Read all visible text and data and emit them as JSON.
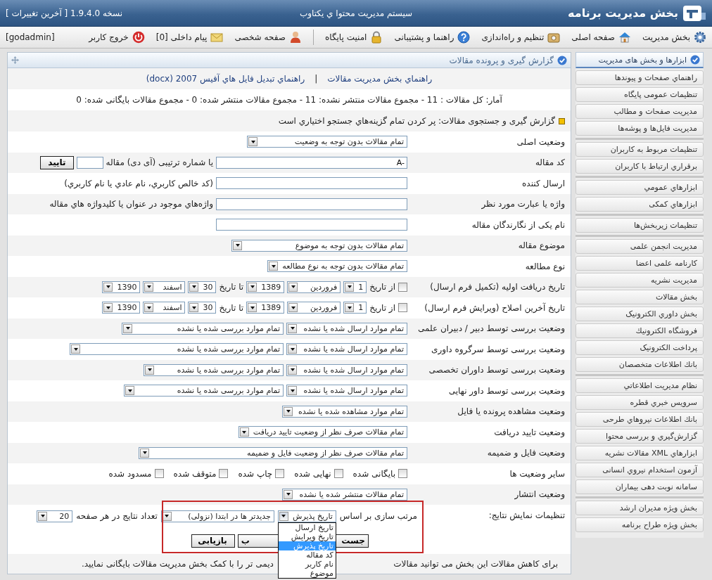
{
  "header": {
    "title": "بخش مدیریت برنامه",
    "subtitle": "سیستم مدیریت محتوا ي يکتاوب",
    "version": "نسخه 1.9.4.0 [ آخرین تغییرات ]"
  },
  "toolbar": {
    "groups": [
      {
        "items": [
          {
            "kind": "gear",
            "label": "بخش مدیریت"
          },
          {
            "kind": "home",
            "label": "صفحه اصلی"
          },
          {
            "kind": "setup",
            "label": "تنظیم و راه‌اندازی"
          },
          {
            "kind": "help",
            "label": "راهنما و پشتیبانی"
          },
          {
            "kind": "lock",
            "label": "امنیت پایگاه"
          }
        ]
      },
      {
        "items": [
          {
            "kind": "person",
            "label": "صفحه شخصی"
          },
          {
            "kind": "mail",
            "label": "پیام داخلی [0]"
          },
          {
            "kind": "power",
            "label": "خروج کاربر"
          }
        ]
      }
    ],
    "user": "[godadmin]"
  },
  "sidebar": {
    "heading": "ابزارها و بخش های مدیریت",
    "groups": [
      {
        "items": [
          "راهنماي صفحات و پیوندها",
          "تنظیمات عمومی پایگاه",
          "مدیریت صفحات و مطالب",
          "مدیریت فایل‌ها و پوشه‌ها"
        ]
      },
      {
        "items": [
          "تنظیمات مربوط به کاربران",
          "برقراري ارتباط با کاربران"
        ]
      },
      {
        "items": [
          "ابزارهاي عمومي",
          "ابزارهاي کمکی"
        ]
      },
      {
        "items": [
          "تنظیمات زیربخش‌ها"
        ]
      },
      {
        "items": [
          "مدیریت انجمن علمی",
          "کارنامه علمی اعضا",
          "مدیریت نشریه",
          "بخش مقالات",
          "بخش داوري الکترونیک",
          "فروشگاه الکترونیك",
          "پرداخت الکترونیک",
          "بانك اطلاعات متخصصان"
        ]
      },
      {
        "items": [
          "نظام مدیریت اطلاعاتي",
          "سرويس خبري قطره",
          "بانك اطلاعات نیروهاي طرحی",
          "گزارش‌گیري و بررسی محتوا",
          "ابزارهاي XML مقالات نشریه",
          "آزمون استخدام نیروي انسانی",
          "سامانه نوبت دهی بیماران"
        ]
      },
      {
        "items": [
          "بخش ویژه مدیران ارشد",
          "بخش ویژه طراح برنامه"
        ]
      }
    ]
  },
  "panel": {
    "title": "گزارش گیری و پرونده مقالات",
    "links": [
      "راهنماي بخش مدیریت مقالات",
      "راهنماي تبدیل فایل هاي آفیس 2007 (docx)"
    ],
    "link_separator": "|",
    "stats": "آمار: کل مقالات : 11 - مجموع مقالات منتشر نشده: 11 - مجموع مقالات منتشر شده: 0 - مجموع مقالات بایگانی شده: 0",
    "search_heading": "گزارش گیری و جستجوی مقالات: پر کردن تمام گزینه‌هاي جستجو اختیاري است",
    "rows": [
      {
        "label": "وضعیت اصلی",
        "controls": [
          {
            "kind": "select",
            "value": "تمام مقالات بدون توجه به وضعیت"
          }
        ]
      },
      {
        "label": "کد مقاله",
        "controls": [
          {
            "kind": "input",
            "value": "A-"
          },
          {
            "kind": "text",
            "text": "یا شماره ترتیبی (آی دی) مقاله"
          },
          {
            "kind": "input"
          },
          {
            "kind": "button",
            "label": "تایید"
          }
        ]
      },
      {
        "label": "ارسال کننده",
        "controls": [
          {
            "kind": "input"
          },
          {
            "kind": "text",
            "text": "(کد خالص کاربري، نام عادي یا نام کاربري)"
          }
        ]
      },
      {
        "label": "واژه یا عبارت مورد نظر",
        "controls": [
          {
            "kind": "input"
          },
          {
            "kind": "text",
            "text": "واژه‌هاي موجود در عنوان یا کلیدواژه هاي مقاله"
          }
        ]
      },
      {
        "label": "نام یکی از نگارندگان مقاله",
        "controls": [
          {
            "kind": "input"
          }
        ]
      },
      {
        "label": "موضوع مقاله",
        "controls": [
          {
            "kind": "select",
            "value": "تمام مقالات بدون توجه به موضوع"
          }
        ]
      },
      {
        "label": "نوع مطالعه",
        "controls": [
          {
            "kind": "select",
            "value": "تمام مقالات بدون توجه به نوع مطالعه"
          }
        ]
      },
      {
        "label": "تاریخ دریافت اولیه (تکمیل فرم ارسال)",
        "controls": [
          {
            "kind": "checkbox",
            "checked": false
          },
          {
            "kind": "text",
            "text": "از تاریخ"
          },
          {
            "kind": "select",
            "value": "1"
          },
          {
            "kind": "select",
            "value": "فروردین"
          },
          {
            "kind": "select",
            "value": "1389"
          },
          {
            "kind": "text",
            "text": "تا تاریخ"
          },
          {
            "kind": "select",
            "value": "30"
          },
          {
            "kind": "select",
            "value": "اسفند"
          },
          {
            "kind": "select",
            "value": "1390"
          }
        ]
      },
      {
        "label": "تاریخ آخرین اصلاح (ویرایش فرم ارسال)",
        "controls": [
          {
            "kind": "checkbox",
            "checked": false
          },
          {
            "kind": "text",
            "text": "از تاریخ"
          },
          {
            "kind": "select",
            "value": "1"
          },
          {
            "kind": "select",
            "value": "فروردین"
          },
          {
            "kind": "select",
            "value": "1389"
          },
          {
            "kind": "text",
            "text": "تا تاریخ"
          },
          {
            "kind": "select",
            "value": "30"
          },
          {
            "kind": "select",
            "value": "اسفند"
          },
          {
            "kind": "select",
            "value": "1390"
          }
        ]
      },
      {
        "label": "وضعیت بررسی توسط دبیر / دبیران علمی",
        "controls": [
          {
            "kind": "select",
            "value": "تمام موارد ارسال شده یا نشده"
          },
          {
            "kind": "select",
            "value": "تمام موارد بررسی شده یا نشده"
          }
        ]
      },
      {
        "label": "وضعیت بررسی توسط سرگروه داوری",
        "controls": [
          {
            "kind": "select",
            "value": "تمام موارد ارسال شده یا نشده"
          },
          {
            "kind": "select",
            "value": "تمام موارد بررسی شده یا نشده"
          }
        ]
      },
      {
        "label": "وضعیت بررسی توسط داوران تخصصی",
        "controls": [
          {
            "kind": "select",
            "value": "تمام موارد ارسال شده یا نشده"
          },
          {
            "kind": "select",
            "value": "تمام موارد بررسی شده یا نشده"
          }
        ]
      },
      {
        "label": "وضعیت بررسی توسط داور نهایی",
        "controls": [
          {
            "kind": "select",
            "value": "تمام موارد ارسال شده یا نشده"
          },
          {
            "kind": "select",
            "value": "تمام موارد بررسی شده یا نشده"
          }
        ]
      },
      {
        "label": "وضعیت مشاهده پرونده یا فایل",
        "controls": [
          {
            "kind": "select",
            "value": "تمام موارد مشاهده شده یا نشده"
          }
        ]
      },
      {
        "label": "وضعیت تایید دریافت",
        "controls": [
          {
            "kind": "select",
            "value": "تمام مقالات صرف نظر از وضعیت تایید دریافت"
          }
        ]
      },
      {
        "label": "وضعیت فایل و ضمیمه",
        "controls": [
          {
            "kind": "select",
            "value": "تمام مقالات صرف نظر از وضعیت فایل و ضمیمه"
          }
        ]
      },
      {
        "label": "سایر وضعیت ها",
        "controls": [
          {
            "kind": "checkbox",
            "checked": false,
            "label": "بایگانی شده"
          },
          {
            "kind": "checkbox",
            "checked": false,
            "label": "نهایی شده"
          },
          {
            "kind": "checkbox",
            "checked": false,
            "label": "چاپ شده"
          },
          {
            "kind": "checkbox",
            "checked": false,
            "label": "متوقف شده"
          },
          {
            "kind": "checkbox",
            "checked": false,
            "label": "مسدود شده"
          }
        ]
      },
      {
        "label": "وضعیت انتشار",
        "controls": [
          {
            "kind": "select",
            "value": "تمام مقالات منتشر شده یا نشده"
          }
        ]
      }
    ],
    "settings": {
      "label": "تنظیمات نمایش نتایج:",
      "highlighted": true,
      "controls": [
        {
          "kind": "text",
          "text": "مرتب سازی بر اساس"
        },
        {
          "kind": "select",
          "value": "تاریخ پذیرش",
          "expanded": true,
          "options": [
            {
              "label": "تاریخ ارسال",
              "selected": false
            },
            {
              "label": "تاریخ ویرایش",
              "selected": false
            },
            {
              "label": "تاریخ پذیرش",
              "selected": true
            },
            {
              "label": "کد مقاله",
              "selected": false
            },
            {
              "label": "نام کاربر",
              "selected": false
            },
            {
              "label": "موضوع",
              "selected": false
            }
          ]
        },
        {
          "kind": "select",
          "value": "جدیدتر ها در ابتدا (نزولی)"
        },
        {
          "kind": "text",
          "text": "تعداد نتایج در هر صفحه"
        },
        {
          "kind": "select",
          "value": "20"
        }
      ],
      "buttons": [
        {
          "label": "جست"
        },
        {
          "label": "ب"
        },
        {
          "label": "بازیابی"
        }
      ]
    },
    "note_parts": [
      "برای کاهش مقالات این بخش می توانید مقالات",
      "دیمی تر را با کمک بخش مدیریت مقالات بایگانی نمایید."
    ]
  }
}
